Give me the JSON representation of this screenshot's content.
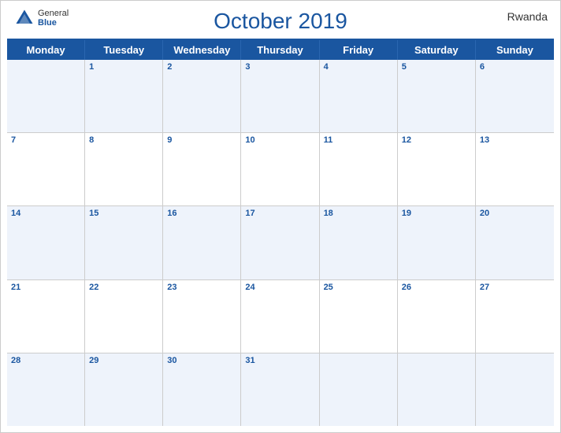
{
  "header": {
    "title": "October 2019",
    "country": "Rwanda",
    "logo_general": "General",
    "logo_blue": "Blue"
  },
  "day_headers": [
    "Monday",
    "Tuesday",
    "Wednesday",
    "Thursday",
    "Friday",
    "Saturday",
    "Sunday"
  ],
  "weeks": [
    [
      {
        "day": "",
        "empty": true
      },
      {
        "day": "1"
      },
      {
        "day": "2"
      },
      {
        "day": "3"
      },
      {
        "day": "4"
      },
      {
        "day": "5"
      },
      {
        "day": "6"
      }
    ],
    [
      {
        "day": "7"
      },
      {
        "day": "8"
      },
      {
        "day": "9"
      },
      {
        "day": "10"
      },
      {
        "day": "11"
      },
      {
        "day": "12"
      },
      {
        "day": "13"
      }
    ],
    [
      {
        "day": "14"
      },
      {
        "day": "15"
      },
      {
        "day": "16"
      },
      {
        "day": "17"
      },
      {
        "day": "18"
      },
      {
        "day": "19"
      },
      {
        "day": "20"
      }
    ],
    [
      {
        "day": "21"
      },
      {
        "day": "22"
      },
      {
        "day": "23"
      },
      {
        "day": "24"
      },
      {
        "day": "25"
      },
      {
        "day": "26"
      },
      {
        "day": "27"
      }
    ],
    [
      {
        "day": "28"
      },
      {
        "day": "29"
      },
      {
        "day": "30"
      },
      {
        "day": "31"
      },
      {
        "day": "",
        "empty": true
      },
      {
        "day": "",
        "empty": true
      },
      {
        "day": "",
        "empty": true
      }
    ]
  ]
}
